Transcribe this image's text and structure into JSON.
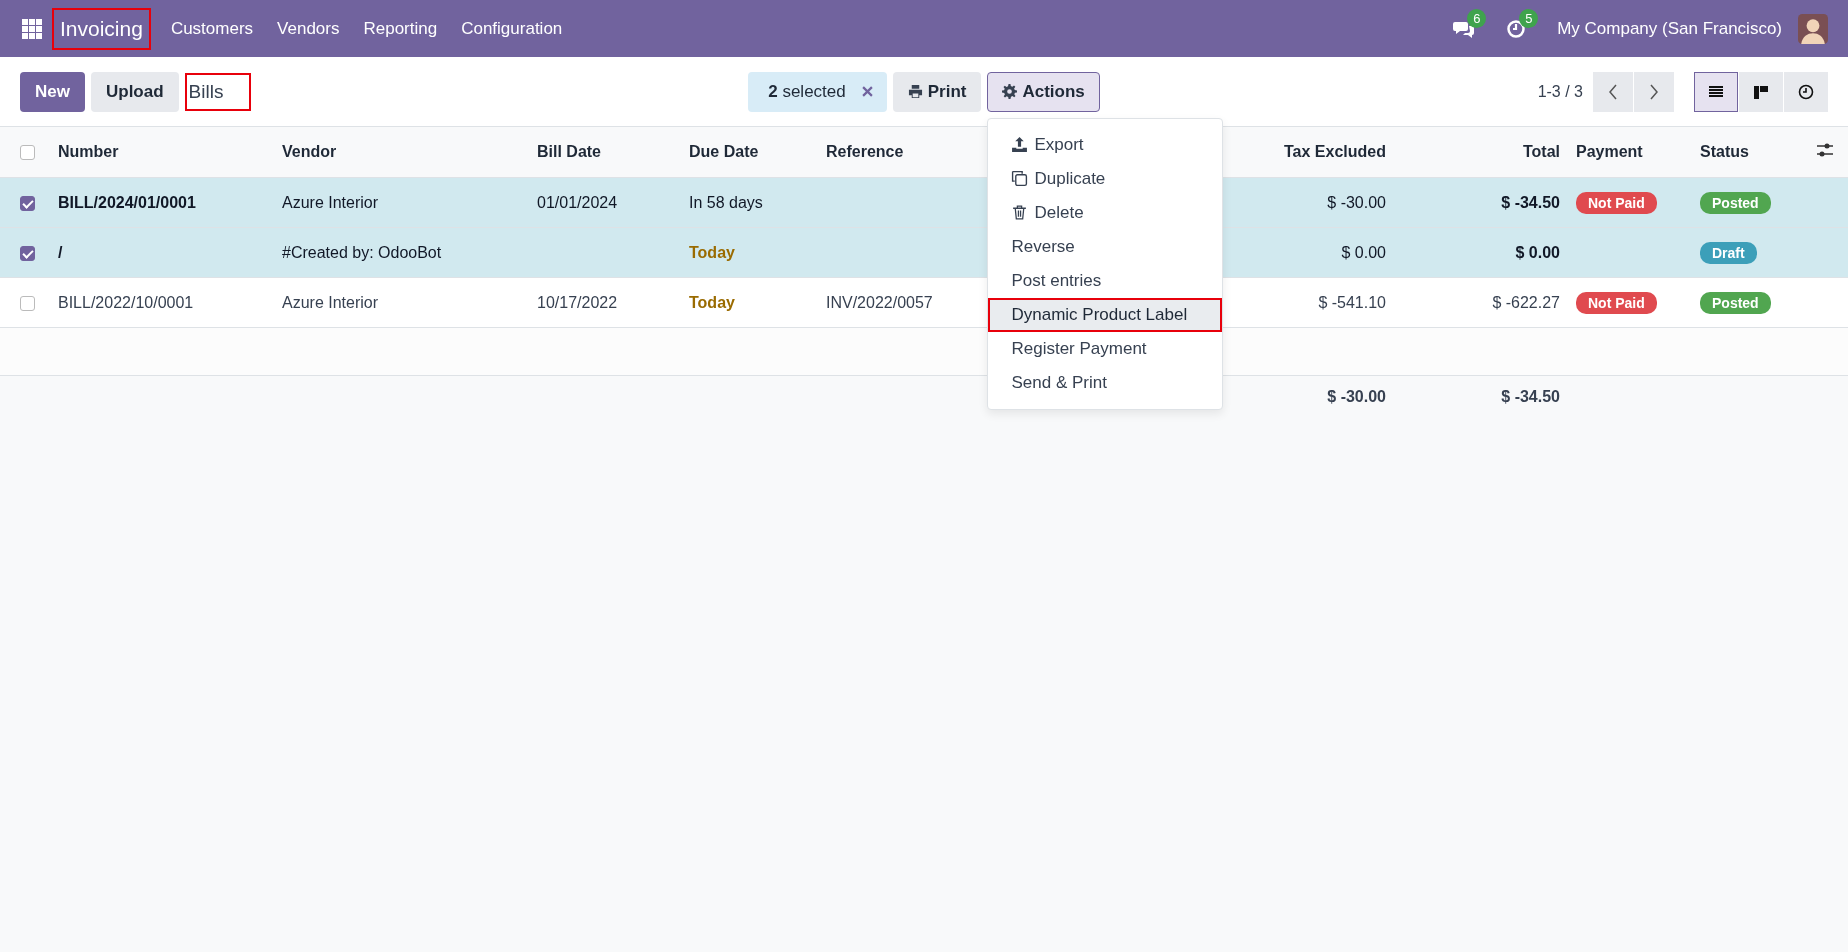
{
  "navbar": {
    "app_name": "Invoicing",
    "app_highlighted": true,
    "menu": [
      "Customers",
      "Vendors",
      "Reporting",
      "Configuration"
    ],
    "messages_count": "6",
    "activities_count": "5",
    "company": "My Company (San Francisco)"
  },
  "control_panel": {
    "buttons": [
      {
        "label": "New",
        "kind": "primary"
      },
      {
        "label": "Upload",
        "kind": "secondary"
      }
    ],
    "breadcrumb": "Bills",
    "breadcrumb_highlighted": true,
    "selection_count": "2",
    "selection_label": "selected",
    "print": "Print",
    "actions": "Actions",
    "pager": "1-3 / 3",
    "views": [
      {
        "kind": "list",
        "selected": true
      },
      {
        "kind": "kanban",
        "selected": false
      },
      {
        "kind": "activity",
        "selected": false
      }
    ]
  },
  "actions_menu": [
    {
      "label": "Export",
      "kind": "export",
      "highlighted": false
    },
    {
      "label": "Duplicate",
      "kind": "duplicate",
      "highlighted": false
    },
    {
      "label": "Delete",
      "kind": "delete",
      "highlighted": false
    },
    {
      "label": "Reverse",
      "kind": "plain",
      "highlighted": false
    },
    {
      "label": "Post entries",
      "kind": "plain",
      "highlighted": false
    },
    {
      "label": "Dynamic Product Label",
      "kind": "plain",
      "highlighted": true
    },
    {
      "label": "Register Payment",
      "kind": "plain",
      "highlighted": false
    },
    {
      "label": "Send & Print",
      "kind": "plain",
      "highlighted": false
    }
  ],
  "table": {
    "all_checked": false,
    "columns": [
      "Number",
      "Vendor",
      "Bill Date",
      "Due Date",
      "Reference",
      "Tax Excluded",
      "Total",
      "Payment",
      "Status"
    ],
    "rows": [
      {
        "selected": true,
        "number": "BILL/2024/01/0001",
        "vendor": "Azure Interior",
        "bill_date": "01/01/2024",
        "due_date": "In 58 days",
        "due_today": false,
        "tax_excluded": "$ -30.00",
        "total": "$ -34.50",
        "payment": {
          "label": "Not Paid",
          "color": "#e04a4f"
        },
        "status": {
          "label": "Posted",
          "color": "#51a650"
        }
      },
      {
        "selected": true,
        "number": "/",
        "vendor": "#Created by: OdooBot",
        "due_date": "Today",
        "due_today": true,
        "tax_excluded": "$ 0.00",
        "total": "$ 0.00",
        "status": {
          "label": "Draft",
          "color": "#3c9fb9"
        }
      },
      {
        "selected": false,
        "number": "BILL/2022/10/0001",
        "vendor": "Azure Interior",
        "bill_date": "10/17/2022",
        "due_date": "Today",
        "due_today": true,
        "reference": "INV/2022/0057",
        "tax_excluded": "$ -541.10",
        "total": "$ -622.27",
        "payment": {
          "label": "Not Paid",
          "color": "#e04a4f"
        },
        "status": {
          "label": "Posted",
          "color": "#51a650"
        }
      }
    ],
    "totals": {
      "tax_excluded": "$ -30.00",
      "total": "$ -34.50"
    }
  }
}
